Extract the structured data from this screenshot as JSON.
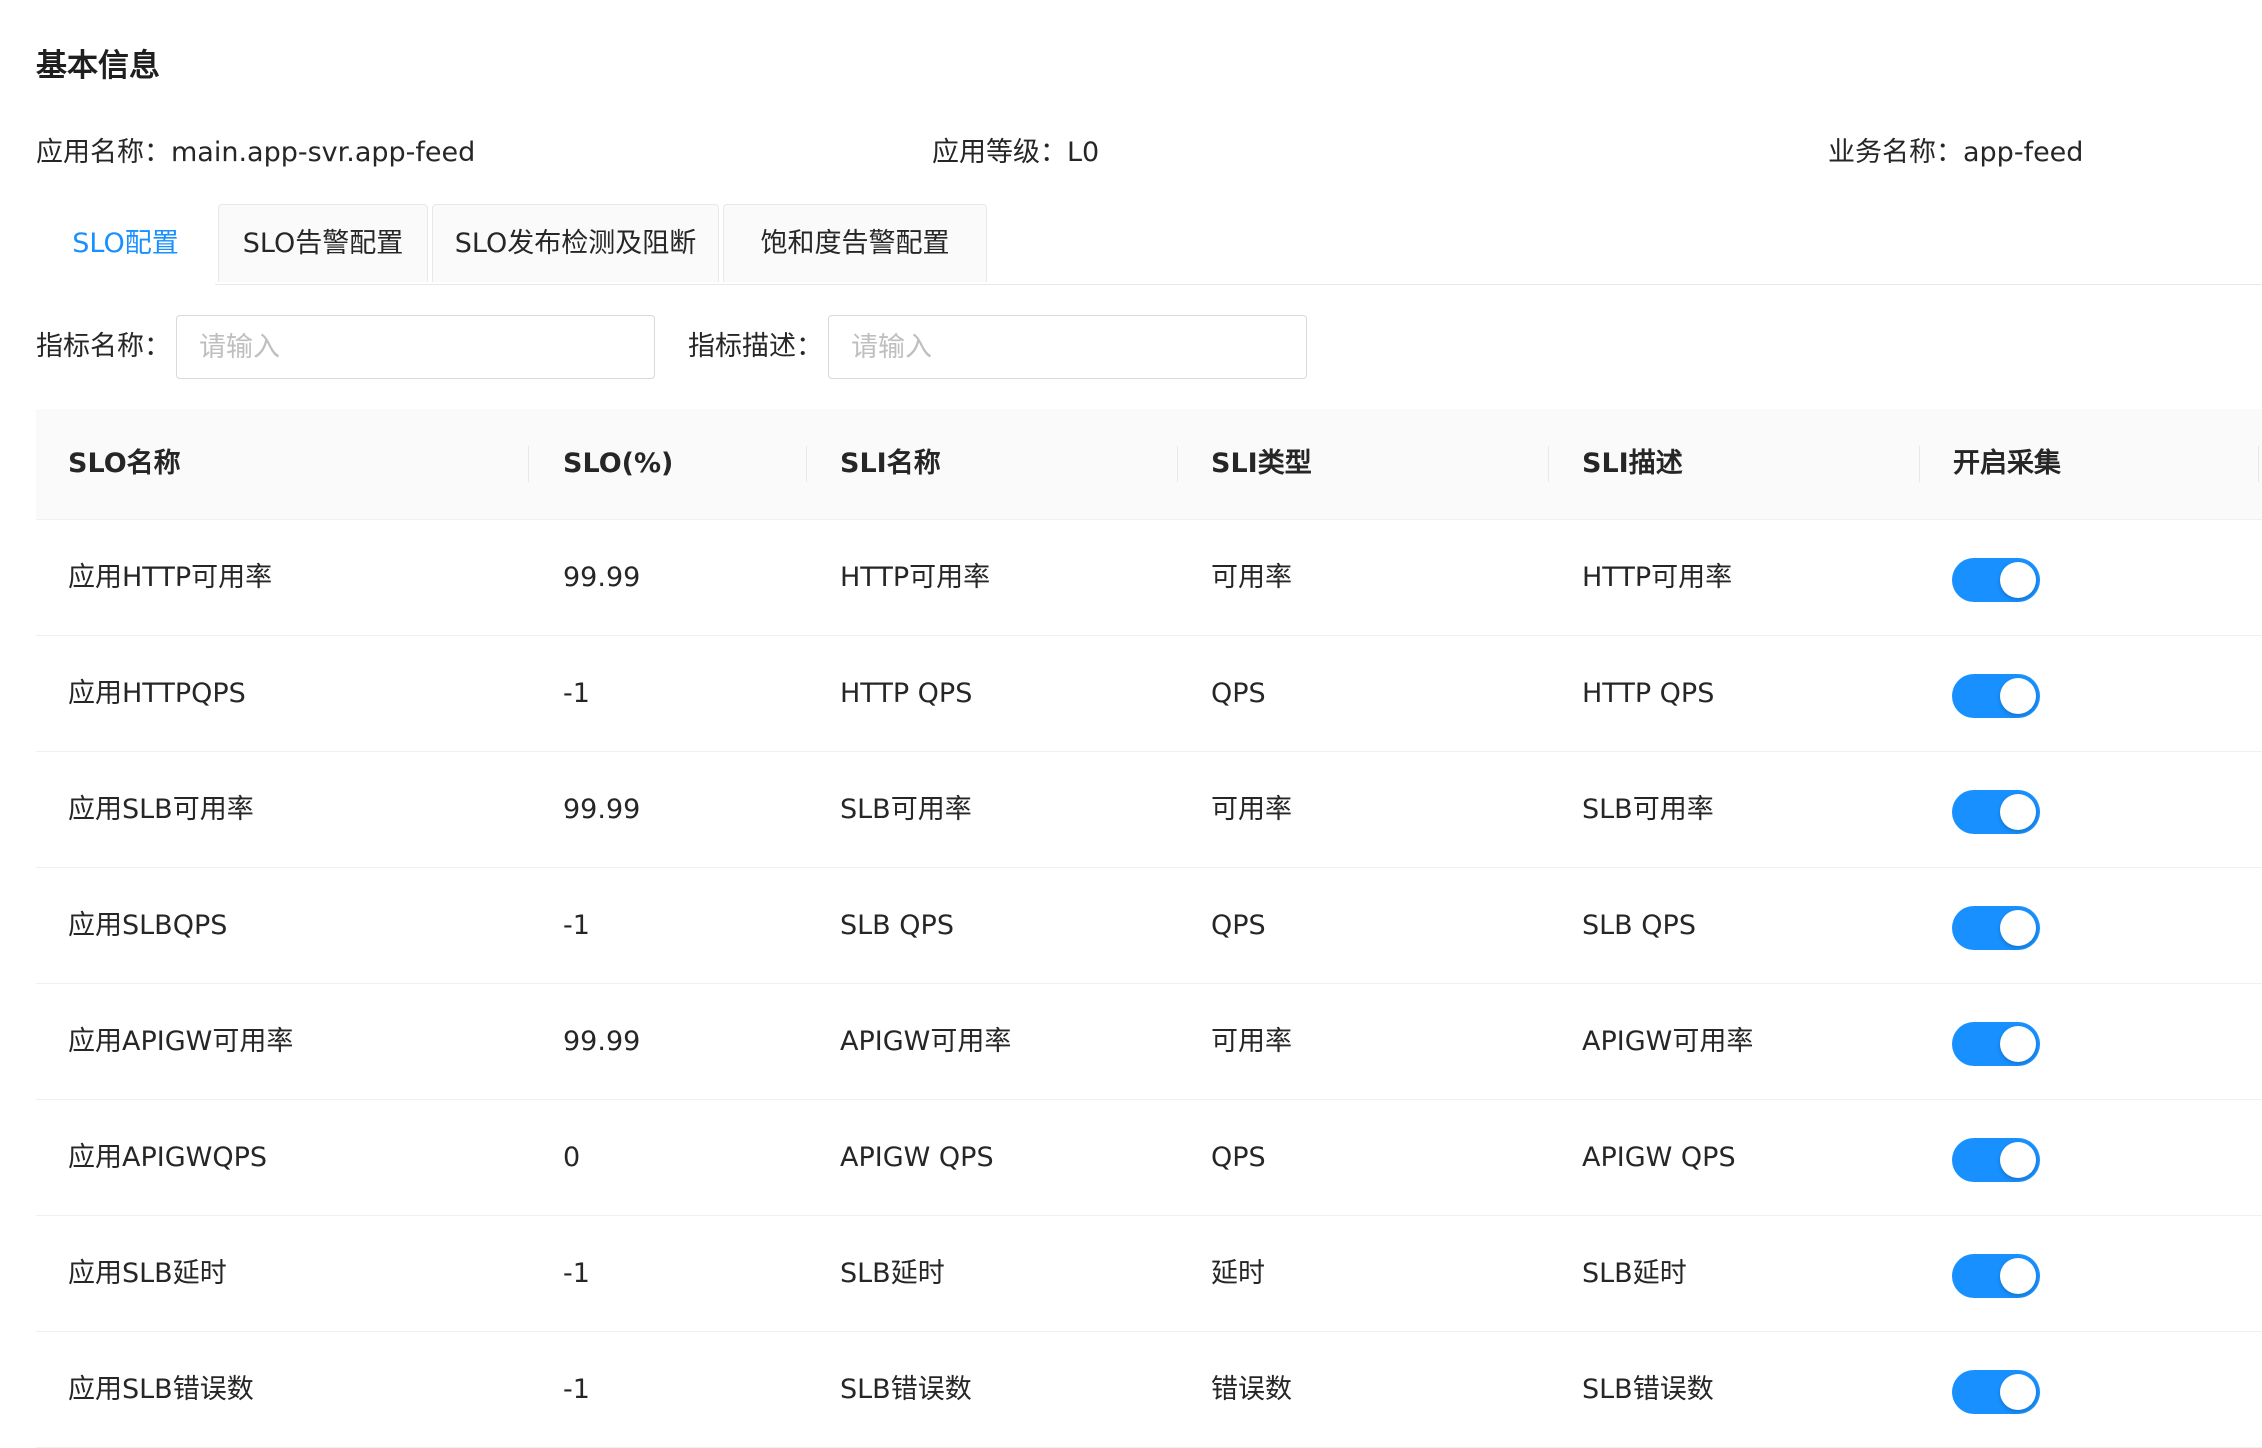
{
  "section_title": "基本信息",
  "info": {
    "app_name": "应用名称：main.app-svr.app-feed",
    "app_level": "应用等级：L0",
    "business_name": "业务名称：app-feed"
  },
  "tabs": [
    {
      "label": "SLO配置",
      "active": true
    },
    {
      "label": "SLO告警配置",
      "active": false
    },
    {
      "label": "SLO发布检测及阻断",
      "active": false
    },
    {
      "label": "饱和度告警配置",
      "active": false
    }
  ],
  "filters": {
    "metric_name_label": "指标名称：",
    "metric_name_placeholder": "请输入",
    "metric_desc_label": "指标描述：",
    "metric_desc_placeholder": "请输入"
  },
  "table": {
    "columns": [
      "SLO名称",
      "SLO(%)",
      "SLI名称",
      "SLI类型",
      "SLI描述",
      "开启采集"
    ],
    "rows": [
      {
        "slo_name": "应用HTTP可用率",
        "slo": "99.99",
        "sli_name": "HTTP可用率",
        "sli_type": "可用率",
        "sli_desc": "HTTP可用率",
        "enabled": true
      },
      {
        "slo_name": "应用HTTPQPS",
        "slo": "-1",
        "sli_name": "HTTP QPS",
        "sli_type": "QPS",
        "sli_desc": "HTTP QPS",
        "enabled": true
      },
      {
        "slo_name": "应用SLB可用率",
        "slo": "99.99",
        "sli_name": "SLB可用率",
        "sli_type": "可用率",
        "sli_desc": "SLB可用率",
        "enabled": true
      },
      {
        "slo_name": "应用SLBQPS",
        "slo": "-1",
        "sli_name": "SLB QPS",
        "sli_type": "QPS",
        "sli_desc": "SLB QPS",
        "enabled": true
      },
      {
        "slo_name": "应用APIGW可用率",
        "slo": "99.99",
        "sli_name": "APIGW可用率",
        "sli_type": "可用率",
        "sli_desc": "APIGW可用率",
        "enabled": true
      },
      {
        "slo_name": "应用APIGWQPS",
        "slo": "0",
        "sli_name": "APIGW QPS",
        "sli_type": "QPS",
        "sli_desc": "APIGW QPS",
        "enabled": true
      },
      {
        "slo_name": "应用SLB延时",
        "slo": "-1",
        "sli_name": "SLB延时",
        "sli_type": "延时",
        "sli_desc": "SLB延时",
        "enabled": true
      },
      {
        "slo_name": "应用SLB错误数",
        "slo": "-1",
        "sli_name": "SLB错误数",
        "sli_type": "错误数",
        "sli_desc": "SLB错误数",
        "enabled": true
      }
    ]
  },
  "colors": {
    "accent": "#1890ff",
    "header_bg": "#fafafa",
    "border": "#f0f0f0"
  }
}
